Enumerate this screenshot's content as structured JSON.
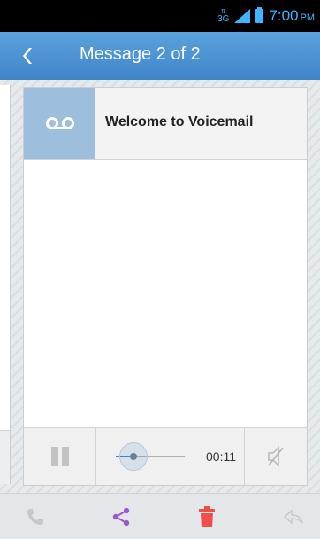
{
  "status_bar": {
    "network": "3G",
    "time": "7:00",
    "ampm": "PM"
  },
  "action_bar": {
    "title": "Message 2 of 2",
    "back_icon": "chevron-left-icon"
  },
  "message": {
    "title": "Welcome to Voicemail",
    "icon": "voicemail-icon"
  },
  "player": {
    "elapsed": "00:11",
    "progress": 0.3,
    "pause_icon": "pause-icon",
    "mute_icon": "speaker-muted-icon"
  },
  "bottom_bar": {
    "call_icon": "phone-icon",
    "share_icon": "share-icon",
    "delete_icon": "trash-icon",
    "reply_icon": "reply-icon"
  },
  "colors": {
    "accent": "#3f86c9",
    "share": "#9b59c9",
    "delete": "#f04e4e",
    "status_text": "#3fb5ff"
  }
}
